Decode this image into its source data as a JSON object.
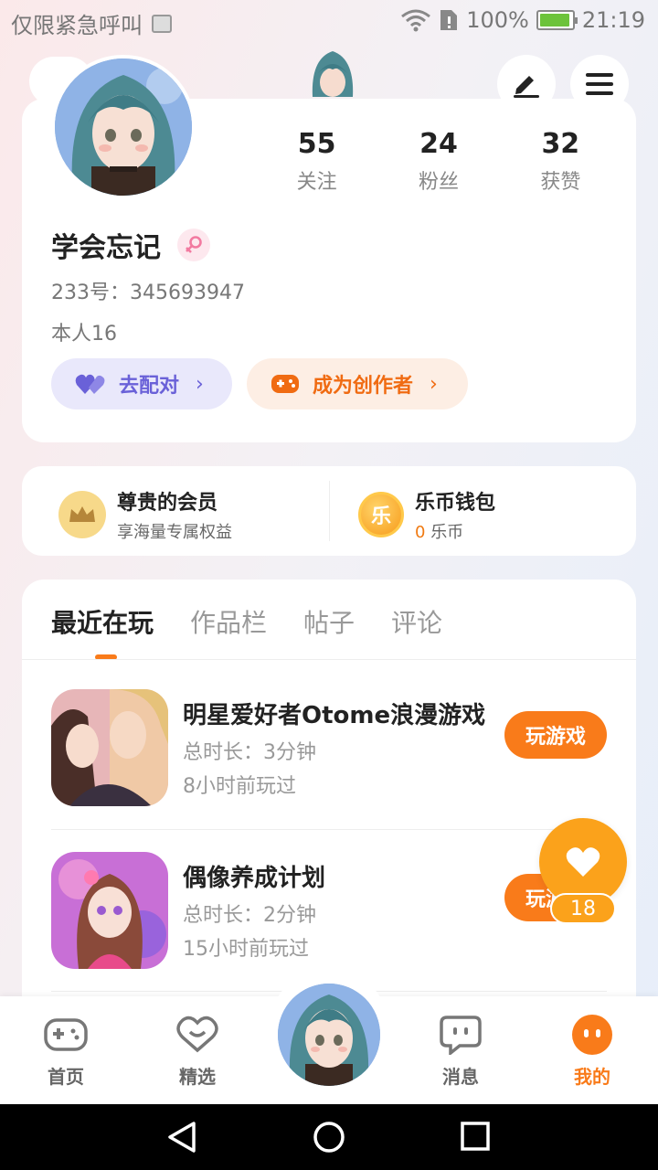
{
  "status_bar": {
    "left_text": "仅限紧急呼叫",
    "battery_percent": "100%",
    "time": "21:19",
    "battery_color": "#6cc33a"
  },
  "header": {
    "edit_icon": "pen-icon",
    "menu_icon": "hamburger-icon"
  },
  "profile": {
    "stats": [
      {
        "value": "55",
        "label": "关注"
      },
      {
        "value": "24",
        "label": "粉丝"
      },
      {
        "value": "32",
        "label": "获赞"
      }
    ],
    "username": "学会忘记",
    "gender_icon": "female-icon",
    "uid": "233号：345693947",
    "bio": "本人16",
    "match_button": "去配对",
    "creator_button": "成为创作者",
    "match_color": "#6a61d8",
    "creator_color": "#f06b12"
  },
  "membership": {
    "vip_title": "尊贵的会员",
    "vip_sub": "享海量专属权益",
    "wallet_title": "乐币钱包",
    "wallet_amount": "0",
    "wallet_unit": "乐币",
    "coin_glyph": "乐"
  },
  "tabs": [
    "最近在玩",
    "作品栏",
    "帖子",
    "评论"
  ],
  "games": [
    {
      "name": "明星爱好者Otome浪漫游戏",
      "duration": "总时长：3分钟",
      "last_played": "8小时前玩过",
      "button": "玩游戏"
    },
    {
      "name": "偶像养成计划",
      "duration": "总时长：2分钟",
      "last_played": "15小时前玩过",
      "button": "玩游戏"
    }
  ],
  "floating_like": {
    "count": "18",
    "icon": "heart-icon"
  },
  "bottom_nav": [
    {
      "label": "首页",
      "icon": "gamepad-icon"
    },
    {
      "label": "精选",
      "icon": "heart-chat-icon"
    },
    {
      "label": "消息",
      "icon": "message-icon"
    },
    {
      "label": "我的",
      "icon": "profile-dots-icon"
    }
  ],
  "accent_color": "#f97b1a"
}
